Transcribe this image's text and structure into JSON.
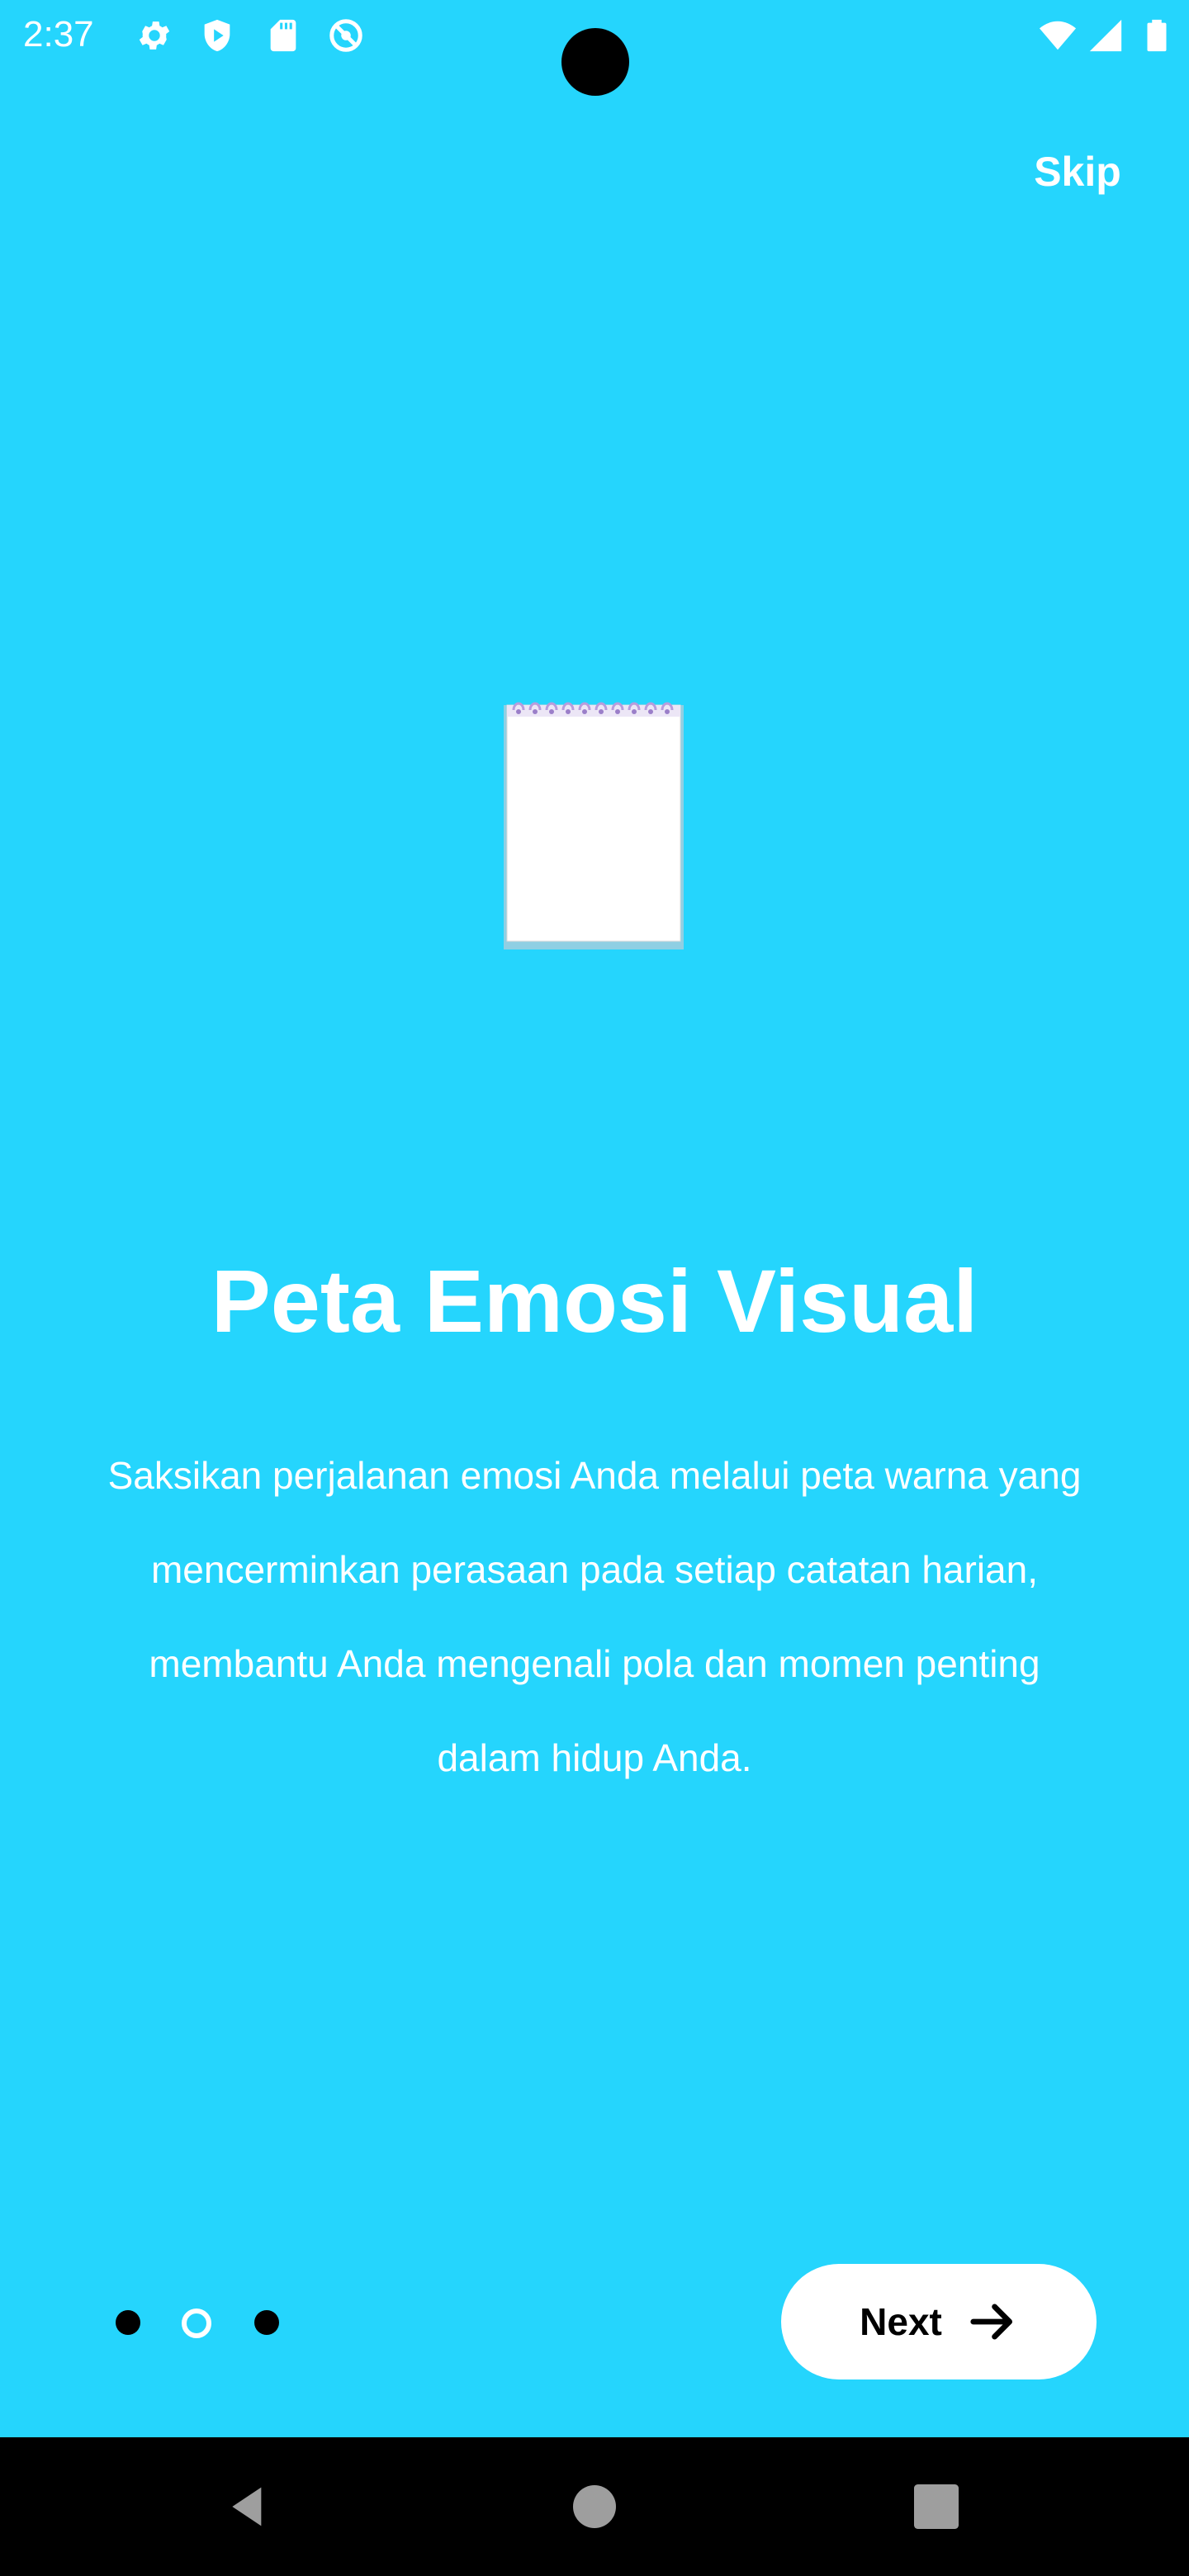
{
  "status_bar": {
    "time": "2:37",
    "left_icons": [
      "gear-icon",
      "shield-icon",
      "sd-card-icon",
      "at-sign-icon"
    ],
    "right_icons": [
      "wifi-icon",
      "cell-signal-icon",
      "battery-icon"
    ]
  },
  "header": {
    "skip_label": "Skip"
  },
  "onboarding": {
    "illustration": "notepad-icon",
    "title": "Peta Emosi Visual",
    "description": "Saksikan perjalanan emosi Anda melalui peta warna yang mencerminkan perasaan pada setiap catatan harian, membantu Anda mengenali pola dan momen penting dalam hidup Anda.",
    "page_count": 3,
    "current_page": 2
  },
  "footer": {
    "next_label": "Next",
    "next_icon": "arrow-right-icon"
  },
  "nav_bar": {
    "buttons": [
      "back-icon",
      "home-icon",
      "recents-icon"
    ]
  },
  "colors": {
    "background": "#25D5FD",
    "button": "#FFFFFF",
    "dot_active": "#000000",
    "nav_bar": "#000000"
  }
}
